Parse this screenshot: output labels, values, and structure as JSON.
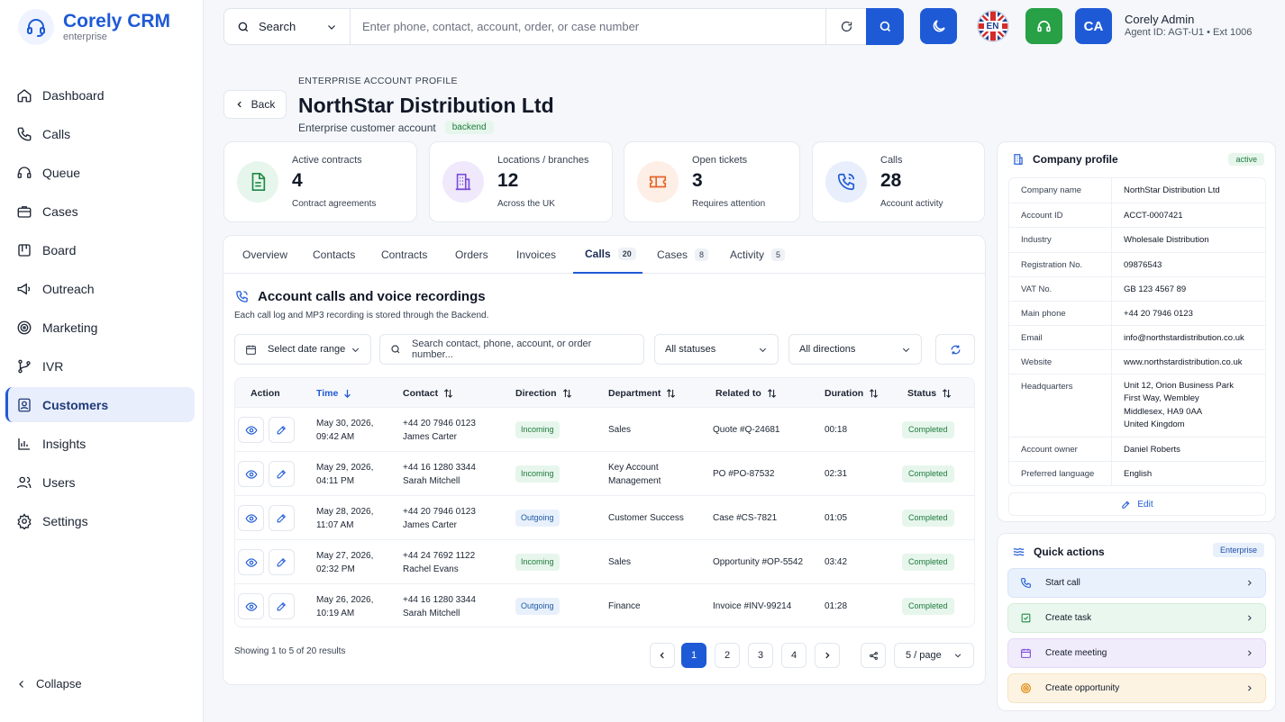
{
  "brand": {
    "name": "Corely CRM",
    "tagline": "enterprise"
  },
  "nav": {
    "items": [
      {
        "label": "Dashboard"
      },
      {
        "label": "Calls"
      },
      {
        "label": "Queue"
      },
      {
        "label": "Cases"
      },
      {
        "label": "Board"
      },
      {
        "label": "Outreach"
      },
      {
        "label": "Marketing"
      },
      {
        "label": "IVR"
      },
      {
        "label": "Customers",
        "active": true
      },
      {
        "label": "Insights"
      },
      {
        "label": "Users"
      },
      {
        "label": "Settings"
      }
    ],
    "collapse_label": "Collapse"
  },
  "search": {
    "scope_label": "Search",
    "placeholder": "Enter phone, contact, account, order, or case number"
  },
  "topbar": {
    "language_code": "EN",
    "avatar_initials": "CA",
    "user_name": "Corely Admin",
    "user_meta": "Agent ID: AGT-U1 • Ext 1006"
  },
  "page": {
    "breadcrumb": "ENTERPRISE ACCOUNT PROFILE",
    "back_label": "Back",
    "title": "NorthStar Distribution Ltd",
    "subtitle": "Enterprise customer account",
    "badge": "backend"
  },
  "stats": [
    {
      "label": "Active contracts",
      "value": "4",
      "desc": "Contract agreements"
    },
    {
      "label": "Locations / branches",
      "value": "12",
      "desc": "Across the UK"
    },
    {
      "label": "Open tickets",
      "value": "3",
      "desc": "Requires attention"
    },
    {
      "label": "Calls",
      "value": "28",
      "desc": "Account activity"
    }
  ],
  "tabs": [
    {
      "label": "Overview",
      "count": null
    },
    {
      "label": "Contacts",
      "count": null
    },
    {
      "label": "Contracts",
      "count": null
    },
    {
      "label": "Orders",
      "count": null
    },
    {
      "label": "Invoices",
      "count": null
    },
    {
      "label": "Calls",
      "count": "20",
      "active": true
    },
    {
      "label": "Cases",
      "count": "8"
    },
    {
      "label": "Activity",
      "count": "5"
    }
  ],
  "calls": {
    "title": "Account calls and voice recordings",
    "subtitle": "Each call log and MP3 recording is stored through the Backend.",
    "filters": {
      "date_range": "Select date range",
      "search_placeholder": "Search contact, phone, account, or order number...",
      "status": "All statuses",
      "direction": "All directions"
    },
    "columns": [
      "Action",
      "Time",
      "Contact",
      "Direction",
      "Department",
      "Related to",
      "Duration",
      "Status"
    ],
    "rows": [
      {
        "time1": "May 30, 2026,",
        "time2": "09:42 AM",
        "phone": "+44 20 7946 0123",
        "name": "James Carter",
        "direction": "Incoming",
        "dept1": "Sales",
        "dept2": "",
        "related": "Quote #Q-24681",
        "duration": "00:18",
        "status": "Completed"
      },
      {
        "time1": "May 29, 2026,",
        "time2": "04:11 PM",
        "phone": "+44 16 1280 3344",
        "name": "Sarah Mitchell",
        "direction": "Incoming",
        "dept1": "Key Account",
        "dept2": "Management",
        "related": "PO #PO-87532",
        "duration": "02:31",
        "status": "Completed"
      },
      {
        "time1": "May 28, 2026,",
        "time2": "11:07 AM",
        "phone": "+44 20 7946 0123",
        "name": "James Carter",
        "direction": "Outgoing",
        "dept1": "Customer Success",
        "dept2": "",
        "related": "Case #CS-7821",
        "duration": "01:05",
        "status": "Completed"
      },
      {
        "time1": "May 27, 2026,",
        "time2": "02:32 PM",
        "phone": "+44 24 7692 1122",
        "name": "Rachel Evans",
        "direction": "Incoming",
        "dept1": "Sales",
        "dept2": "",
        "related": "Opportunity #OP-5542",
        "duration": "03:42",
        "status": "Completed"
      },
      {
        "time1": "May 26, 2026,",
        "time2": "10:19 AM",
        "phone": "+44 16 1280 3344",
        "name": "Sarah Mitchell",
        "direction": "Outgoing",
        "dept1": "Finance",
        "dept2": "",
        "related": "Invoice #INV-99214",
        "duration": "01:28",
        "status": "Completed"
      }
    ],
    "showing": "Showing 1 to 5 of 20 results",
    "pages": [
      "1",
      "2",
      "3",
      "4"
    ],
    "per_page": "5 / page"
  },
  "company_profile": {
    "title": "Company profile",
    "badge": "active",
    "fields": [
      {
        "key": "Company name",
        "value": "NorthStar Distribution Ltd"
      },
      {
        "key": "Account ID",
        "value": "ACCT-0007421"
      },
      {
        "key": "Industry",
        "value": "Wholesale Distribution"
      },
      {
        "key": "Registration No.",
        "value": "09876543"
      },
      {
        "key": "VAT No.",
        "value": "GB 123 4567 89"
      },
      {
        "key": "Main phone",
        "value": "+44 20 7946 0123"
      },
      {
        "key": "Email",
        "value": "info@northstardistribution.co.uk"
      },
      {
        "key": "Website",
        "value": "www.northstardistribution.co.uk"
      },
      {
        "key": "Headquarters",
        "value": "Unit 12, Orion Business Park",
        "value2": "First Way, Wembley",
        "value3": "Middlesex, HA9 0AA",
        "value4": "United Kingdom"
      },
      {
        "key": "Account owner",
        "value": "Daniel Roberts"
      },
      {
        "key": "Preferred language",
        "value": "English"
      }
    ],
    "edit_label": "Edit"
  },
  "quick_actions": {
    "title": "Quick actions",
    "badge": "Enterprise",
    "items": [
      {
        "label": "Start call",
        "color": "#e9f1fc",
        "icon_color": "#1f5ad6"
      },
      {
        "label": "Create task",
        "color": "#eaf7ee",
        "icon_color": "#1e8a44"
      },
      {
        "label": "Create meeting",
        "color": "#f1ecfb",
        "icon_color": "#7c4ddb"
      },
      {
        "label": "Create opportunity",
        "color": "#fdf3e3",
        "icon_color": "#e0901a"
      }
    ]
  },
  "colors": {
    "accent": "#1f5ad6",
    "success_green": "#27a046",
    "badge_green_bg": "#e7f6ec"
  }
}
